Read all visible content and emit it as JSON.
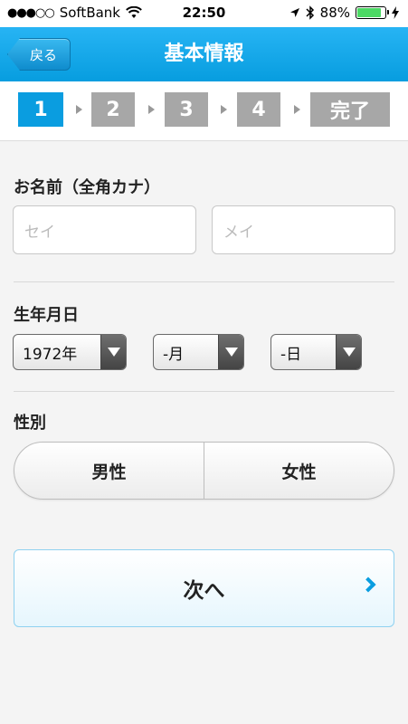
{
  "status_bar": {
    "signal": "●●●○○",
    "carrier": "SoftBank",
    "time": "22:50",
    "battery": "88%",
    "battery_level": 0.88,
    "battery_color": "#4cd964"
  },
  "nav": {
    "back_label": "戻る",
    "title": "基本情報",
    "color": "#0a9de0"
  },
  "steps": [
    "1",
    "2",
    "3",
    "4",
    "完了"
  ],
  "name_section": {
    "label": "お名前（全角カナ）",
    "last_placeholder": "セイ",
    "first_placeholder": "メイ"
  },
  "birth_section": {
    "label": "生年月日",
    "year": "1972年",
    "month": "-月",
    "day": "-日"
  },
  "gender_section": {
    "label": "性別",
    "male": "男性",
    "female": "女性"
  },
  "next_button": {
    "label": "次へ"
  }
}
